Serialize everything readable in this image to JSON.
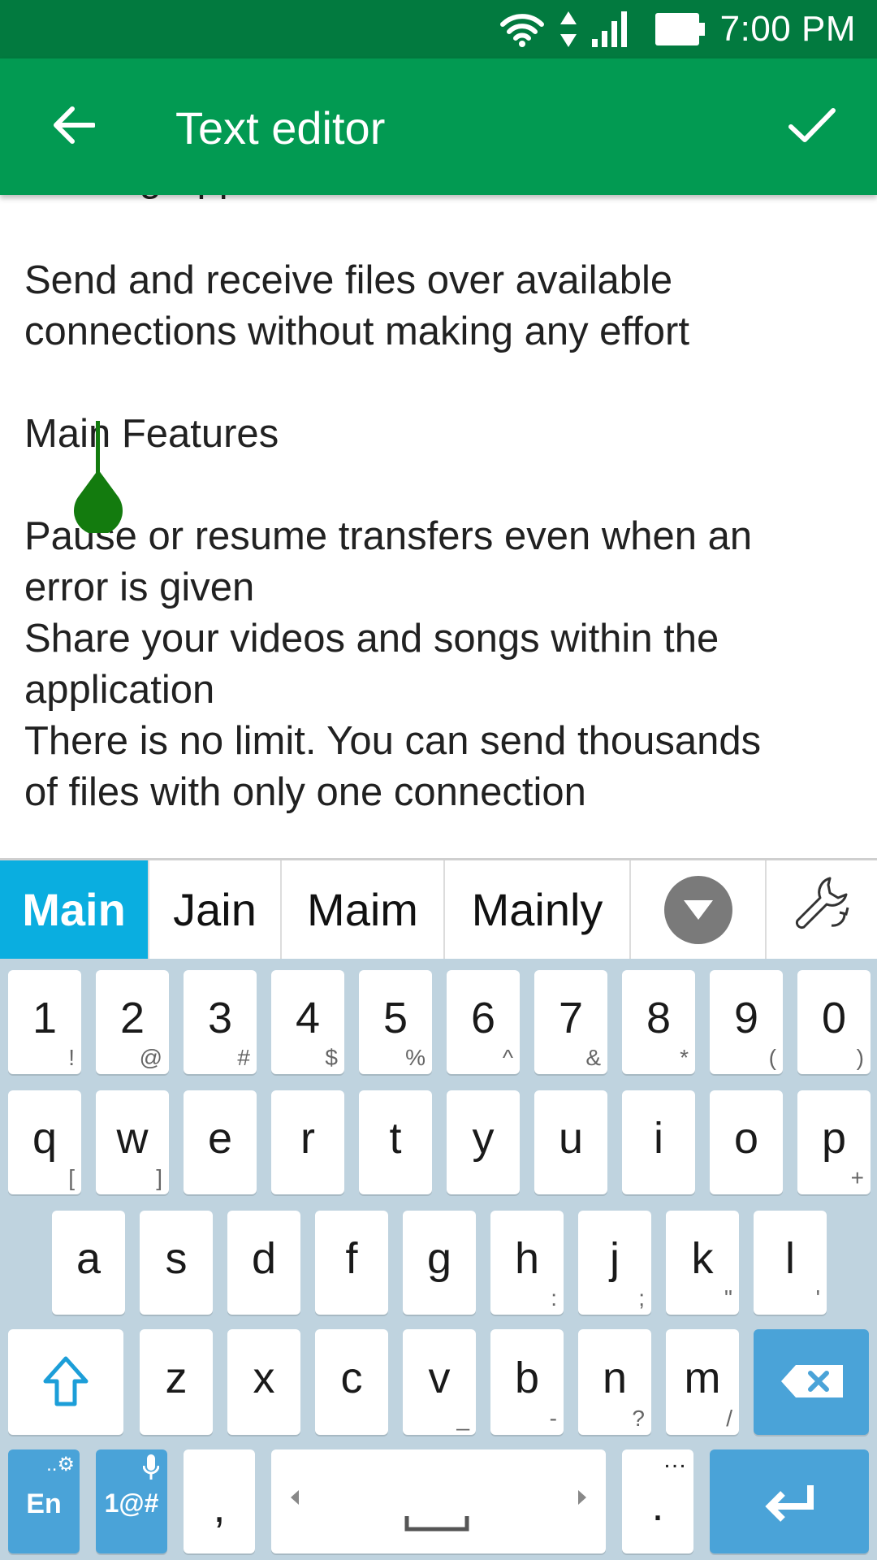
{
  "status_bar": {
    "time": "7:00 PM",
    "icons": [
      "wifi-icon",
      "data-transfer-icon",
      "signal-icon",
      "battery-icon"
    ]
  },
  "app_bar": {
    "title": "Text editor",
    "back_icon": "arrow-left-icon",
    "done_icon": "check-icon",
    "color": "#029A52"
  },
  "editor": {
    "lines": [
      "Sharing Application",
      "",
      "Send and receive files over available",
      "connections without making any effort",
      "",
      "Main Features",
      "",
      "Pause or resume transfers even when an",
      "error is given",
      "Share your videos and songs within the",
      "application",
      "There is no limit. You can send thousands",
      "of files with only one connection"
    ]
  },
  "suggestions": {
    "items": [
      "Main",
      "Jain",
      "Maim",
      "Mainly"
    ],
    "expand_icon": "triangle-down-icon",
    "settings_icon": "wrench-icon"
  },
  "keyboard": {
    "row1": [
      {
        "k": "1",
        "s": "!"
      },
      {
        "k": "2",
        "s": "@"
      },
      {
        "k": "3",
        "s": "#"
      },
      {
        "k": "4",
        "s": "$"
      },
      {
        "k": "5",
        "s": "%"
      },
      {
        "k": "6",
        "s": "^"
      },
      {
        "k": "7",
        "s": "&"
      },
      {
        "k": "8",
        "s": "*"
      },
      {
        "k": "9",
        "s": "("
      },
      {
        "k": "0",
        "s": ")"
      }
    ],
    "row2": [
      {
        "k": "q",
        "s": "["
      },
      {
        "k": "w",
        "s": "]"
      },
      {
        "k": "e",
        "s": ""
      },
      {
        "k": "r",
        "s": ""
      },
      {
        "k": "t",
        "s": ""
      },
      {
        "k": "y",
        "s": ""
      },
      {
        "k": "u",
        "s": ""
      },
      {
        "k": "i",
        "s": ""
      },
      {
        "k": "o",
        "s": ""
      },
      {
        "k": "p",
        "s": "+"
      }
    ],
    "row3": [
      {
        "k": "a",
        "s": ""
      },
      {
        "k": "s",
        "s": ""
      },
      {
        "k": "d",
        "s": ""
      },
      {
        "k": "f",
        "s": ""
      },
      {
        "k": "g",
        "s": ""
      },
      {
        "k": "h",
        "s": ":"
      },
      {
        "k": "j",
        "s": ";"
      },
      {
        "k": "k",
        "s": "\""
      },
      {
        "k": "l",
        "s": "'"
      }
    ],
    "row4": [
      {
        "k": "z",
        "s": ""
      },
      {
        "k": "x",
        "s": ""
      },
      {
        "k": "c",
        "s": ""
      },
      {
        "k": "v",
        "s": "_"
      },
      {
        "k": "b",
        "s": "-"
      },
      {
        "k": "n",
        "s": "?"
      },
      {
        "k": "m",
        "s": "/"
      }
    ],
    "lang_label": "En",
    "symbols_label": "1@#",
    "comma_label": ",",
    "period_label": ".",
    "period_sub": "…",
    "shift_icon": "shift-icon",
    "backspace_icon": "backspace-icon",
    "enter_icon": "enter-icon",
    "mic_icon": "mic-icon",
    "settings_small_icon": "gear-icon",
    "space_icon": "space-bar-icon"
  }
}
